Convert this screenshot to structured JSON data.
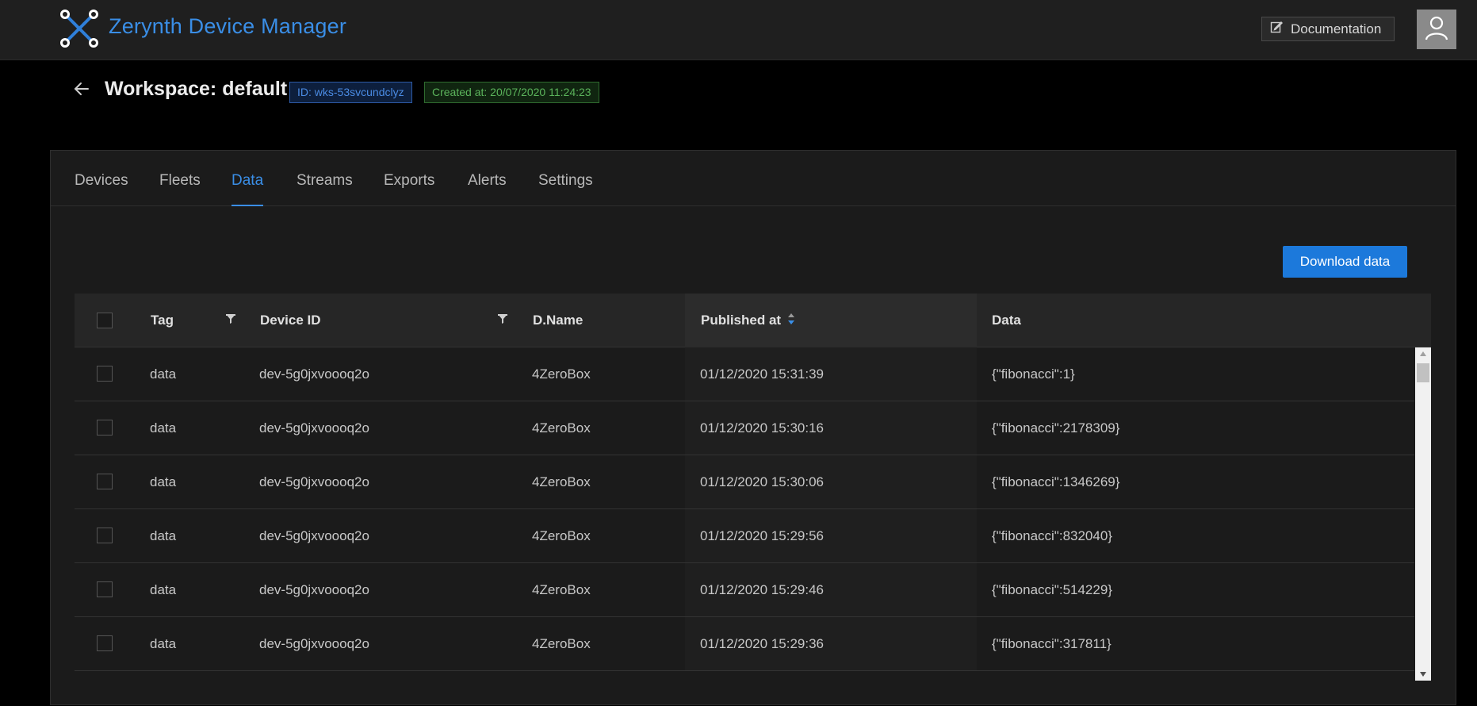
{
  "app": {
    "brand": "Zerynth Device Manager",
    "logo_icon": "zerynth-logo-icon"
  },
  "topbar": {
    "documentation_label": "Documentation",
    "documentation_icon": "edit-icon",
    "user_icon": "user-icon"
  },
  "workspace": {
    "title": "Workspace: default",
    "id_badge": "ID: wks-53svcundclyz",
    "created_badge": "Created at: 20/07/2020 11:24:23"
  },
  "tabs": [
    {
      "label": "Devices"
    },
    {
      "label": "Fleets"
    },
    {
      "label": "Data",
      "active": true
    },
    {
      "label": "Streams"
    },
    {
      "label": "Exports"
    },
    {
      "label": "Alerts"
    },
    {
      "label": "Settings"
    }
  ],
  "actions": {
    "download_label": "Download data"
  },
  "table": {
    "columns": {
      "tag": "Tag",
      "device_id": "Device ID",
      "dname": "D.Name",
      "published_at": "Published at",
      "data": "Data"
    },
    "rows": [
      {
        "tag": "data",
        "device_id": "dev-5g0jxvoooq2o",
        "dname": "4ZeroBox",
        "published_at": "01/12/2020 15:31:39",
        "data": "{\"fibonacci\":1}"
      },
      {
        "tag": "data",
        "device_id": "dev-5g0jxvoooq2o",
        "dname": "4ZeroBox",
        "published_at": "01/12/2020 15:30:16",
        "data": "{\"fibonacci\":2178309}"
      },
      {
        "tag": "data",
        "device_id": "dev-5g0jxvoooq2o",
        "dname": "4ZeroBox",
        "published_at": "01/12/2020 15:30:06",
        "data": "{\"fibonacci\":1346269}"
      },
      {
        "tag": "data",
        "device_id": "dev-5g0jxvoooq2o",
        "dname": "4ZeroBox",
        "published_at": "01/12/2020 15:29:56",
        "data": "{\"fibonacci\":832040}"
      },
      {
        "tag": "data",
        "device_id": "dev-5g0jxvoooq2o",
        "dname": "4ZeroBox",
        "published_at": "01/12/2020 15:29:46",
        "data": "{\"fibonacci\":514229}"
      },
      {
        "tag": "data",
        "device_id": "dev-5g0jxvoooq2o",
        "dname": "4ZeroBox",
        "published_at": "01/12/2020 15:29:36",
        "data": "{\"fibonacci\":317811}"
      }
    ]
  },
  "colors": {
    "accent": "#1c79db",
    "brand": "#3a8ee6",
    "id_badge": "#4a8be3",
    "created_badge": "#5bb35b"
  }
}
